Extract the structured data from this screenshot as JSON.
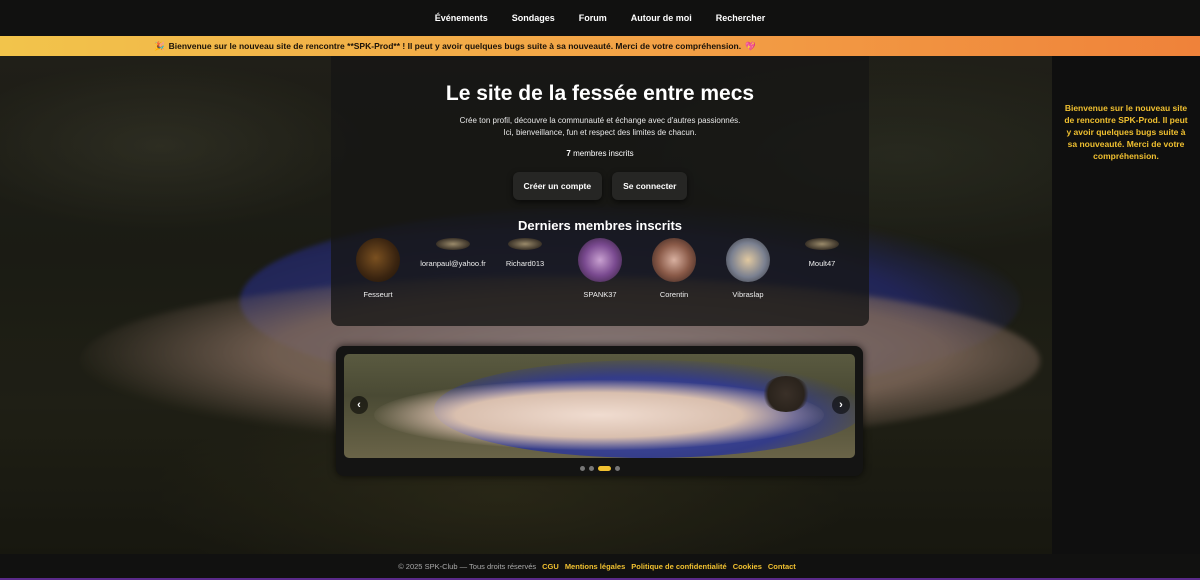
{
  "nav": {
    "items": [
      "Événements",
      "Sondages",
      "Forum",
      "Autour de moi",
      "Rechercher"
    ]
  },
  "banner": {
    "text": "Bienvenue sur le nouveau site de rencontre **SPK-Prod** ! Il peut y avoir quelques bugs suite à sa nouveauté. Merci de votre compréhension.",
    "party_icon": "🎉",
    "heart_icon": "💖"
  },
  "sidebar": {
    "text": "Bienvenue sur le nouveau site de rencontre SPK-Prod. Il peut y avoir quelques bugs suite à sa nouveauté. Merci de votre compréhension."
  },
  "hero": {
    "title": "Le site de la fessée entre mecs",
    "lead_line1": "Crée ton profil, découvre la communauté et échange avec d'autres passionnés.",
    "lead_line2": "Ici, bienveillance, fun et respect des limites de chacun.",
    "member_count": "7",
    "member_count_label": "membres inscrits",
    "signup_label": "Créer un compte",
    "login_label": "Se connecter",
    "members_title": "Derniers membres inscrits"
  },
  "members": [
    {
      "name": "Fesseurt",
      "avatar": "large"
    },
    {
      "name": "loranpaul@yahoo.fr",
      "avatar": "small"
    },
    {
      "name": "Richard013",
      "avatar": "small"
    },
    {
      "name": "SPANK37",
      "avatar": "large"
    },
    {
      "name": "Corentin",
      "avatar": "large"
    },
    {
      "name": "Vibraslap",
      "avatar": "large"
    },
    {
      "name": "Moult47",
      "avatar": "small"
    }
  ],
  "carousel": {
    "prev_icon": "‹",
    "next_icon": "›",
    "slide_count": 4,
    "active_slide": 3
  },
  "colors": {
    "accent": "#f0c030",
    "banner_start": "#f2c44b",
    "banner_end": "#ef823a"
  },
  "footer": {
    "copyright": "© 2025 SPK-Club — Tous droits réservés",
    "links": [
      "CGU",
      "Mentions légales",
      "Politique de confidentialité",
      "Cookies",
      "Contact"
    ]
  }
}
